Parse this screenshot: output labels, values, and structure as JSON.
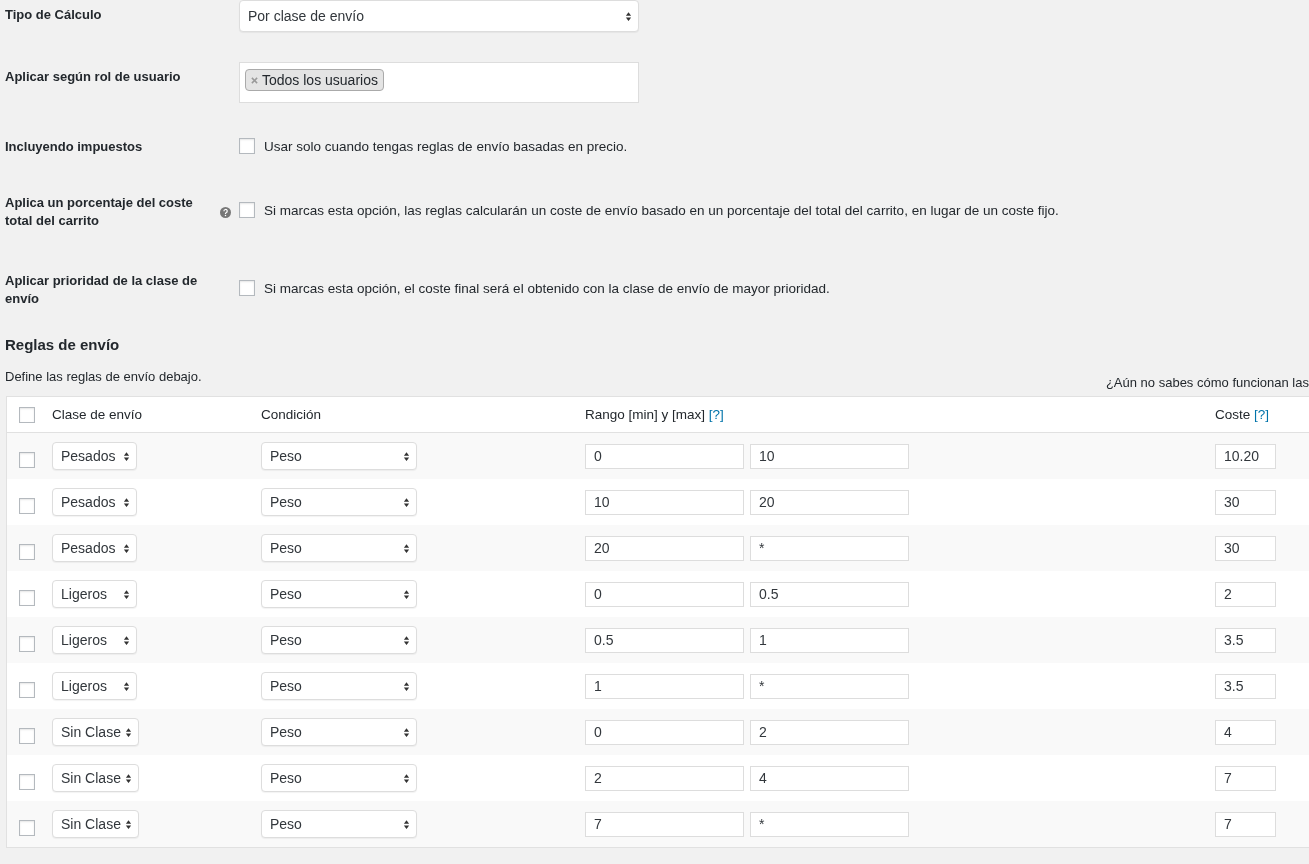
{
  "settings": [
    {
      "kind": "select",
      "label": "Tipo de Cálculo",
      "value": "Por clase de envío"
    },
    {
      "kind": "tags",
      "label": "Aplicar según rol de usuario",
      "tags": [
        "Todos los usuarios"
      ]
    },
    {
      "kind": "checkbox",
      "label": "Incluyendo impuestos",
      "checked": false,
      "description": "Usar solo cuando tengas reglas de envío basadas en precio."
    },
    {
      "kind": "checkbox",
      "label": "Aplica un porcentaje del coste total del carrito",
      "help": true,
      "checked": false,
      "description": "Si marcas esta opción, las reglas calcularán un coste de envío basado en un porcentaje del total del carrito, en lugar de un coste fijo."
    },
    {
      "kind": "checkbox",
      "label": "Aplicar prioridad de la clase de envío",
      "checked": false,
      "description": "Si marcas esta opción, el coste final será el obtenido con la clase de envío de mayor prioridad."
    }
  ],
  "rules": {
    "title": "Reglas de envío",
    "description": "Define las reglas de envío debajo.",
    "help_link": "¿Aún no sabes cómo funcionan las",
    "columns": {
      "select_all_checked": false,
      "class": "Clase de envío",
      "condition": "Condición",
      "range": "Rango [min] y [max]",
      "range_help": "[?]",
      "cost": "Coste",
      "cost_help": "[?]"
    },
    "rows": [
      {
        "checked": false,
        "class": "Pesados",
        "condition": "Peso",
        "min": "0",
        "max": "10",
        "cost": "10.20"
      },
      {
        "checked": false,
        "class": "Pesados",
        "condition": "Peso",
        "min": "10",
        "max": "20",
        "cost": "30"
      },
      {
        "checked": false,
        "class": "Pesados",
        "condition": "Peso",
        "min": "20",
        "max": "*",
        "cost": "30"
      },
      {
        "checked": false,
        "class": "Ligeros",
        "condition": "Peso",
        "min": "0",
        "max": "0.5",
        "cost": "2"
      },
      {
        "checked": false,
        "class": "Ligeros",
        "condition": "Peso",
        "min": "0.5",
        "max": "1",
        "cost": "3.5"
      },
      {
        "checked": false,
        "class": "Ligeros",
        "condition": "Peso",
        "min": "1",
        "max": "*",
        "cost": "3.5"
      },
      {
        "checked": false,
        "class": "Sin Clase",
        "condition": "Peso",
        "min": "0",
        "max": "2",
        "cost": "4"
      },
      {
        "checked": false,
        "class": "Sin Clase",
        "condition": "Peso",
        "min": "2",
        "max": "4",
        "cost": "7"
      },
      {
        "checked": false,
        "class": "Sin Clase",
        "condition": "Peso",
        "min": "7",
        "max": "*",
        "cost": "7"
      }
    ]
  }
}
